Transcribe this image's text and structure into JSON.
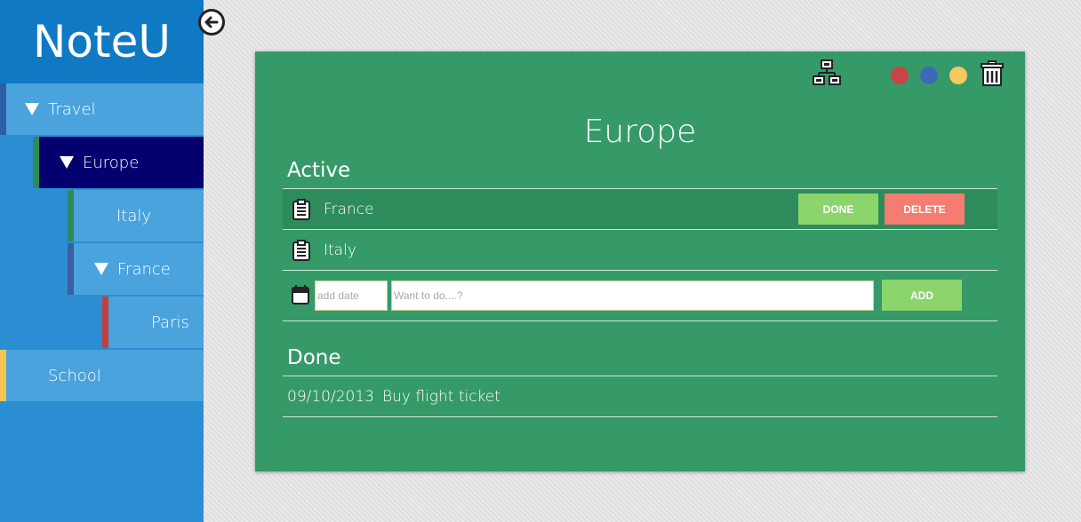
{
  "app": {
    "title": "NoteU"
  },
  "sidebar": {
    "items": [
      {
        "label": "Travel",
        "collapsible": true,
        "strip_color": "#2d5fa8"
      },
      {
        "label": "Europe",
        "collapsible": true,
        "strip_color": "#2e8b57",
        "selected": true
      },
      {
        "label": "Italy",
        "collapsible": false,
        "strip_color": "#2e8b57"
      },
      {
        "label": "France",
        "collapsible": true,
        "strip_color": "#3a5ea3"
      },
      {
        "label": "Paris",
        "collapsible": false,
        "strip_color": "#c0413f"
      },
      {
        "label": "School",
        "collapsible": false,
        "strip_color": "#f5c552"
      }
    ]
  },
  "card": {
    "title": "Europe",
    "colors": [
      "#c84446",
      "#3d6ab8",
      "#f7c85e"
    ],
    "active": {
      "heading": "Active",
      "tasks": [
        {
          "text": "France",
          "highlighted": true
        },
        {
          "text": "Italy",
          "highlighted": false
        }
      ],
      "done_label": "DONE",
      "delete_label": "DELETE"
    },
    "new_task": {
      "date_placeholder": "add date",
      "text_placeholder": "Want to do....?",
      "add_label": "ADD"
    },
    "done": {
      "heading": "Done",
      "items": [
        {
          "date": "09/10/2013",
          "text": "Buy flight ticket"
        }
      ]
    }
  }
}
